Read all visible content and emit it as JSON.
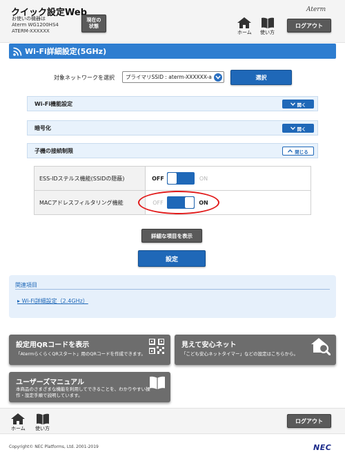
{
  "header": {
    "app_title": "クイック設定Web",
    "device_caption": "お使いの機器は",
    "device_model": "Aterm WG1200HS4",
    "device_name": "ATERM-XXXXXX",
    "status_button": "現在の状態",
    "home_label": "ホーム",
    "guide_label": "使い方",
    "brand": "Aterm",
    "logout_button": "ログアウト"
  },
  "section": {
    "title": "Wi-Fi詳細設定(5GHz)"
  },
  "network": {
    "label": "対象ネットワークを選択",
    "selected": "プライマリSSID : aterm-XXXXXX-a",
    "select_button": "選択"
  },
  "accordions": [
    {
      "label": "Wi-Fi機能設定",
      "button": "開く",
      "state": "collapsed"
    },
    {
      "label": "暗号化",
      "button": "開く",
      "state": "collapsed"
    },
    {
      "label": "子機の接続制限",
      "button": "閉じる",
      "state": "expanded"
    }
  ],
  "settings": [
    {
      "name": "ESS-IDステルス機能(SSIDの隠蔽)",
      "off": "OFF",
      "on": "ON",
      "value": "OFF"
    },
    {
      "name": "MACアドレスフィルタリング機能",
      "off": "OFF",
      "on": "ON",
      "value": "ON"
    }
  ],
  "buttons": {
    "show_details": "詳細な項目を表示",
    "apply": "設定"
  },
  "related": {
    "heading": "関連項目",
    "link": "Wi-Fi詳細設定（2.4GHz）"
  },
  "tiles": [
    {
      "title": "設定用QRコードを表示",
      "desc": "「AtermらくらくQRスタート」用のQRコードを作成できます。",
      "icon": "qr-code-icon"
    },
    {
      "title": "見えて安心ネット",
      "desc": "「こども安心ネットタイマー」などの設定はこちらから。",
      "icon": "home-search-icon"
    },
    {
      "title": "ユーザーズマニュアル",
      "desc_line1": "本商品のさまざまな機能を利用してできることを、わかりやすい操",
      "desc_line2": "作・設定手順で説明しています。",
      "icon": "book-icon"
    }
  ],
  "footer": {
    "home_label": "ホーム",
    "guide_label": "使い方",
    "logout_button": "ログアウト",
    "copyright": "Copyright© NEC Platforms, Ltd. 2001-2019",
    "logo": "NEC"
  },
  "colors": {
    "accent": "#2e7dd0",
    "button_blue": "#1f68b8",
    "highlight": "#e11a1a",
    "tile_gray": "#6d6d6d"
  }
}
